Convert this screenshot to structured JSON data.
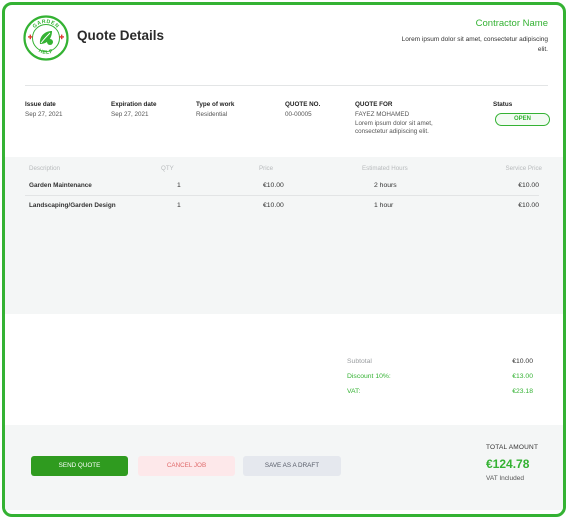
{
  "header": {
    "logo_text_top": "GARDEN",
    "logo_text_bottom": "HELP",
    "title": "Quote Details",
    "contractor_name": "Contractor Name",
    "contractor_desc": "Lorem ipsum dolor sit amet, consectetur adipiscing elit."
  },
  "meta": {
    "issue_date_label": "Issue date",
    "issue_date": "Sep 27, 2021",
    "expiration_label": "Expiration date",
    "expiration_date": "Sep 27, 2021",
    "work_type_label": "Type of work",
    "work_type": "Residential",
    "quote_no_label": "QUOTE NO.",
    "quote_no": "00-00005",
    "quote_for_label": "QUOTE FOR",
    "quote_for_name": "FAYEZ MOHAMED",
    "quote_for_desc": "Lorem ipsum dolor sit amet, consectetur adipiscing elit.",
    "status_label": "Status",
    "status": "OPEN"
  },
  "items": {
    "headers": {
      "description": "Description",
      "qty": "QTY",
      "price": "Price",
      "hours": "Estimated Hours",
      "service_price": "Service Price"
    },
    "rows": [
      {
        "description": "Garden Maintenance",
        "qty": "1",
        "price": "€10.00",
        "hours": "2 hours",
        "service_price": "€10.00"
      },
      {
        "description": "Landscaping/Garden Design",
        "qty": "1",
        "price": "€10.00",
        "hours": "1 hour",
        "service_price": "€10.00"
      }
    ]
  },
  "totals": {
    "subtotal_label": "Subtotal",
    "subtotal": "€10.00",
    "discount_label": "Discount 10%:",
    "discount": "€13.00",
    "vat_label": "VAT:",
    "vat": "€23.18"
  },
  "footer": {
    "send_label": "SEND QUOTE",
    "cancel_label": "CANCEL JOB",
    "draft_label": "SAVE AS A DRAFT",
    "total_label": "TOTAL AMOUNT",
    "total_value": "€124.78",
    "vat_note": "VAT Included"
  },
  "colors": {
    "accent": "#34b233",
    "send_button": "#2f9b1f",
    "cancel_bg": "#fde8ea",
    "cancel_text": "#e06a6a",
    "draft_bg": "#e5e8ee",
    "panel_bg": "#f4f6f6"
  },
  "icons": {
    "logo": "garden-help-logo-icon"
  }
}
